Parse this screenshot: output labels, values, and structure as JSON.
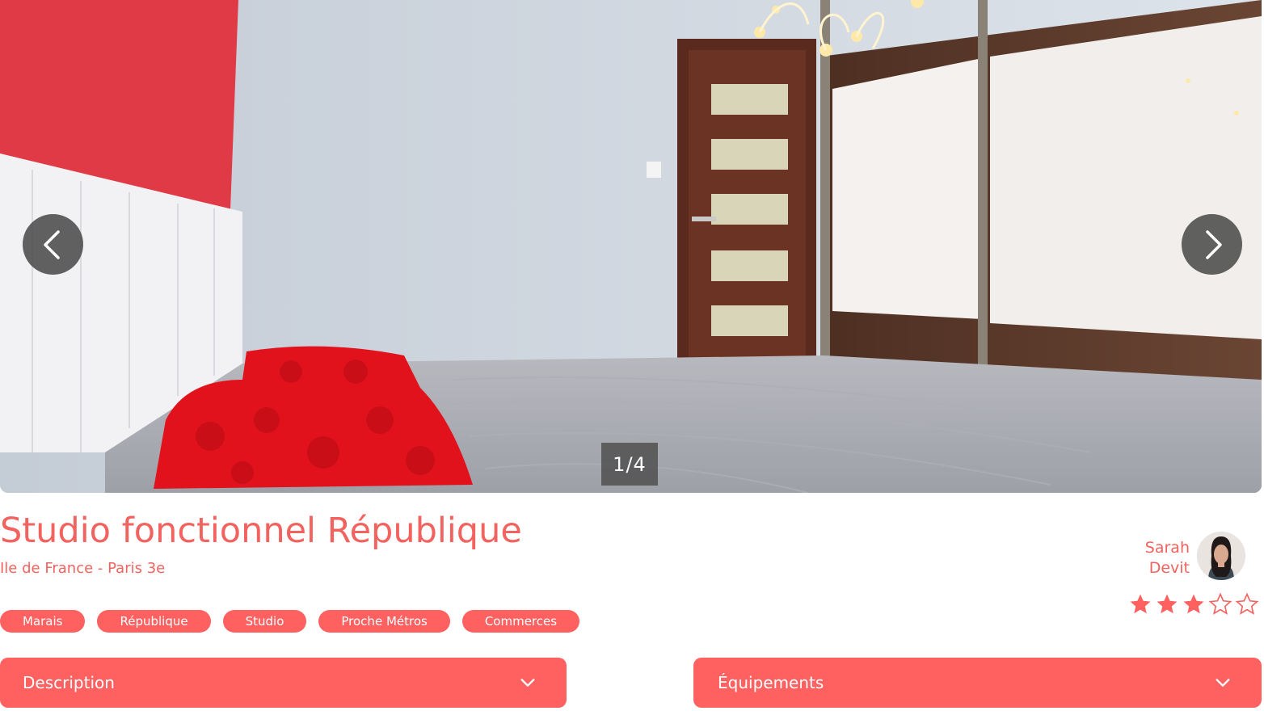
{
  "carousel": {
    "image_alt": "Chambre avec lit et coussin rouge",
    "counter_current": "1",
    "counter_separator": "/",
    "counter_total": "4",
    "prev_icon": "chevron-left-icon",
    "next_icon": "chevron-right-icon"
  },
  "listing": {
    "title": "Studio fonctionnel République",
    "location": "Ile de France - Paris 3e",
    "tags": [
      "Marais",
      "République",
      "Studio",
      "Proche Métros",
      "Commerces"
    ]
  },
  "host": {
    "first_name": "Sarah",
    "last_name": "Devit",
    "rating": 3,
    "rating_max": 5
  },
  "sections": {
    "description_label": "Description",
    "equipments_label": "Équipements"
  },
  "colors": {
    "accent": "#ff6060",
    "text_accent": "#f2635f",
    "star_empty": "#f2635f"
  }
}
